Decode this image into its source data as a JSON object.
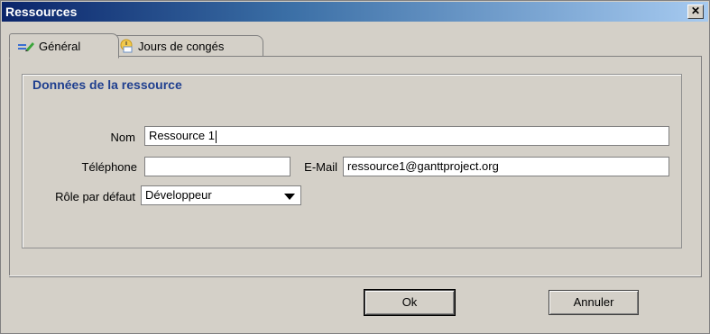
{
  "window": {
    "title": "Ressources"
  },
  "tabs": [
    {
      "label": "Général",
      "icon": "edit-icon",
      "active": true
    },
    {
      "label": "Jours de congés",
      "icon": "clock-icon",
      "active": false
    }
  ],
  "group": {
    "title": "Données de la ressource"
  },
  "form": {
    "name_label": "Nom",
    "name_value": "Ressource 1",
    "phone_label": "Téléphone",
    "phone_value": "",
    "email_label": "E-Mail",
    "email_value": "ressource1@ganttproject.org",
    "role_label": "Rôle par défaut",
    "role_value": "Développeur"
  },
  "buttons": {
    "ok": "Ok",
    "cancel": "Annuler"
  },
  "colors": {
    "title_gradient_start": "#0a246a",
    "group_title": "#1f3f8f"
  }
}
